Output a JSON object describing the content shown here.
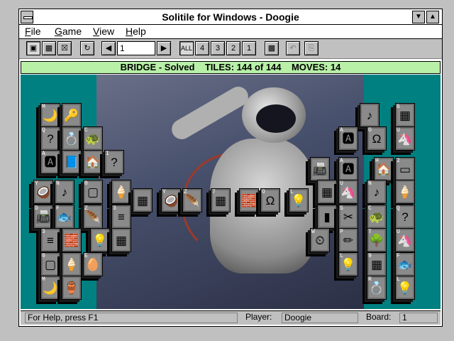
{
  "window": {
    "title": "Solitile for Windows - Doogie"
  },
  "menu": [
    "File",
    "Game",
    "View",
    "Help"
  ],
  "toolbar": {
    "level_value": "1",
    "all_label": "ALL",
    "n4": "4",
    "n3": "3",
    "n2": "2",
    "n1": "1"
  },
  "status": {
    "layout": "BRIDGE - Solved",
    "tiles": "TILES: 144 of 144",
    "moves": "MOVES: 14"
  },
  "footer": {
    "help": "For Help, press F1",
    "player_label": "Player:",
    "player_value": "Doogie",
    "board_label": "Board:",
    "board_value": "1"
  },
  "tiles": [
    {
      "idx": "M",
      "glyph": "🌙"
    },
    {
      "idx": "",
      "glyph": "🔑"
    },
    {
      "idx": "Q",
      "glyph": "?"
    },
    {
      "idx": "",
      "glyph": "💍"
    },
    {
      "idx": "C",
      "glyph": "🐢"
    },
    {
      "idx": "A",
      "glyph": "🅰"
    },
    {
      "idx": "",
      "glyph": "📘"
    },
    {
      "idx": "",
      "glyph": "🏠"
    },
    {
      "idx": "I",
      "glyph": "?"
    },
    {
      "idx": "Y",
      "glyph": "🥥"
    },
    {
      "idx": "N",
      "glyph": "♪"
    },
    {
      "idx": "0",
      "glyph": "▢"
    },
    {
      "idx": "",
      "glyph": "🍦"
    },
    {
      "idx": "",
      "glyph": "▦"
    },
    {
      "idx": "Y",
      "glyph": "🥥"
    },
    {
      "idx": "Z",
      "glyph": "🪶"
    },
    {
      "idx": "7",
      "glyph": "▦"
    },
    {
      "idx": "",
      "glyph": "🧱"
    },
    {
      "idx": "O",
      "glyph": "Ω"
    },
    {
      "idx": "L",
      "glyph": "💡"
    },
    {
      "idx": "D",
      "glyph": "📠"
    },
    {
      "idx": "F",
      "glyph": "🐟"
    },
    {
      "idx": "Z",
      "glyph": "🪶"
    },
    {
      "idx": "3",
      "glyph": "≡"
    },
    {
      "idx": "3",
      "glyph": "≡"
    },
    {
      "idx": "",
      "glyph": "🧱"
    },
    {
      "idx": "",
      "glyph": "💡"
    },
    {
      "idx": "",
      "glyph": "▦"
    },
    {
      "idx": "0",
      "glyph": "▢"
    },
    {
      "idx": "E",
      "glyph": "🥚"
    },
    {
      "idx": "",
      "glyph": "🍦"
    },
    {
      "idx": "M",
      "glyph": "🌙"
    },
    {
      "idx": "",
      "glyph": "🏺"
    },
    {
      "idx": "",
      "glyph": "♪"
    },
    {
      "idx": "6",
      "glyph": "▦"
    },
    {
      "idx": "A",
      "glyph": "🅰"
    },
    {
      "idx": "O",
      "glyph": "Ω"
    },
    {
      "idx": "U",
      "glyph": "🦄"
    },
    {
      "idx": "",
      "glyph": "📠"
    },
    {
      "idx": "A",
      "glyph": "🅰"
    },
    {
      "idx": "H",
      "glyph": "🏠"
    },
    {
      "idx": "2",
      "glyph": "▭"
    },
    {
      "idx": "",
      "glyph": "▦"
    },
    {
      "idx": "U",
      "glyph": "🦄"
    },
    {
      "idx": "N",
      "glyph": "♪"
    },
    {
      "idx": "",
      "glyph": "🍦"
    },
    {
      "idx": "",
      "glyph": "▮"
    },
    {
      "idx": "S",
      "glyph": "✂"
    },
    {
      "idx": "C",
      "glyph": "🐢"
    },
    {
      "idx": "Q",
      "glyph": "?"
    },
    {
      "idx": "W",
      "glyph": "⏲"
    },
    {
      "idx": "P",
      "glyph": "✏"
    },
    {
      "idx": "T",
      "glyph": "🌳"
    },
    {
      "idx": "U",
      "glyph": "🦄"
    },
    {
      "idx": "L",
      "glyph": "💡"
    },
    {
      "idx": "9",
      "glyph": "▦"
    },
    {
      "idx": "F",
      "glyph": "🐟"
    },
    {
      "idx": "R",
      "glyph": "💍"
    },
    {
      "idx": "L",
      "glyph": "💡"
    }
  ]
}
